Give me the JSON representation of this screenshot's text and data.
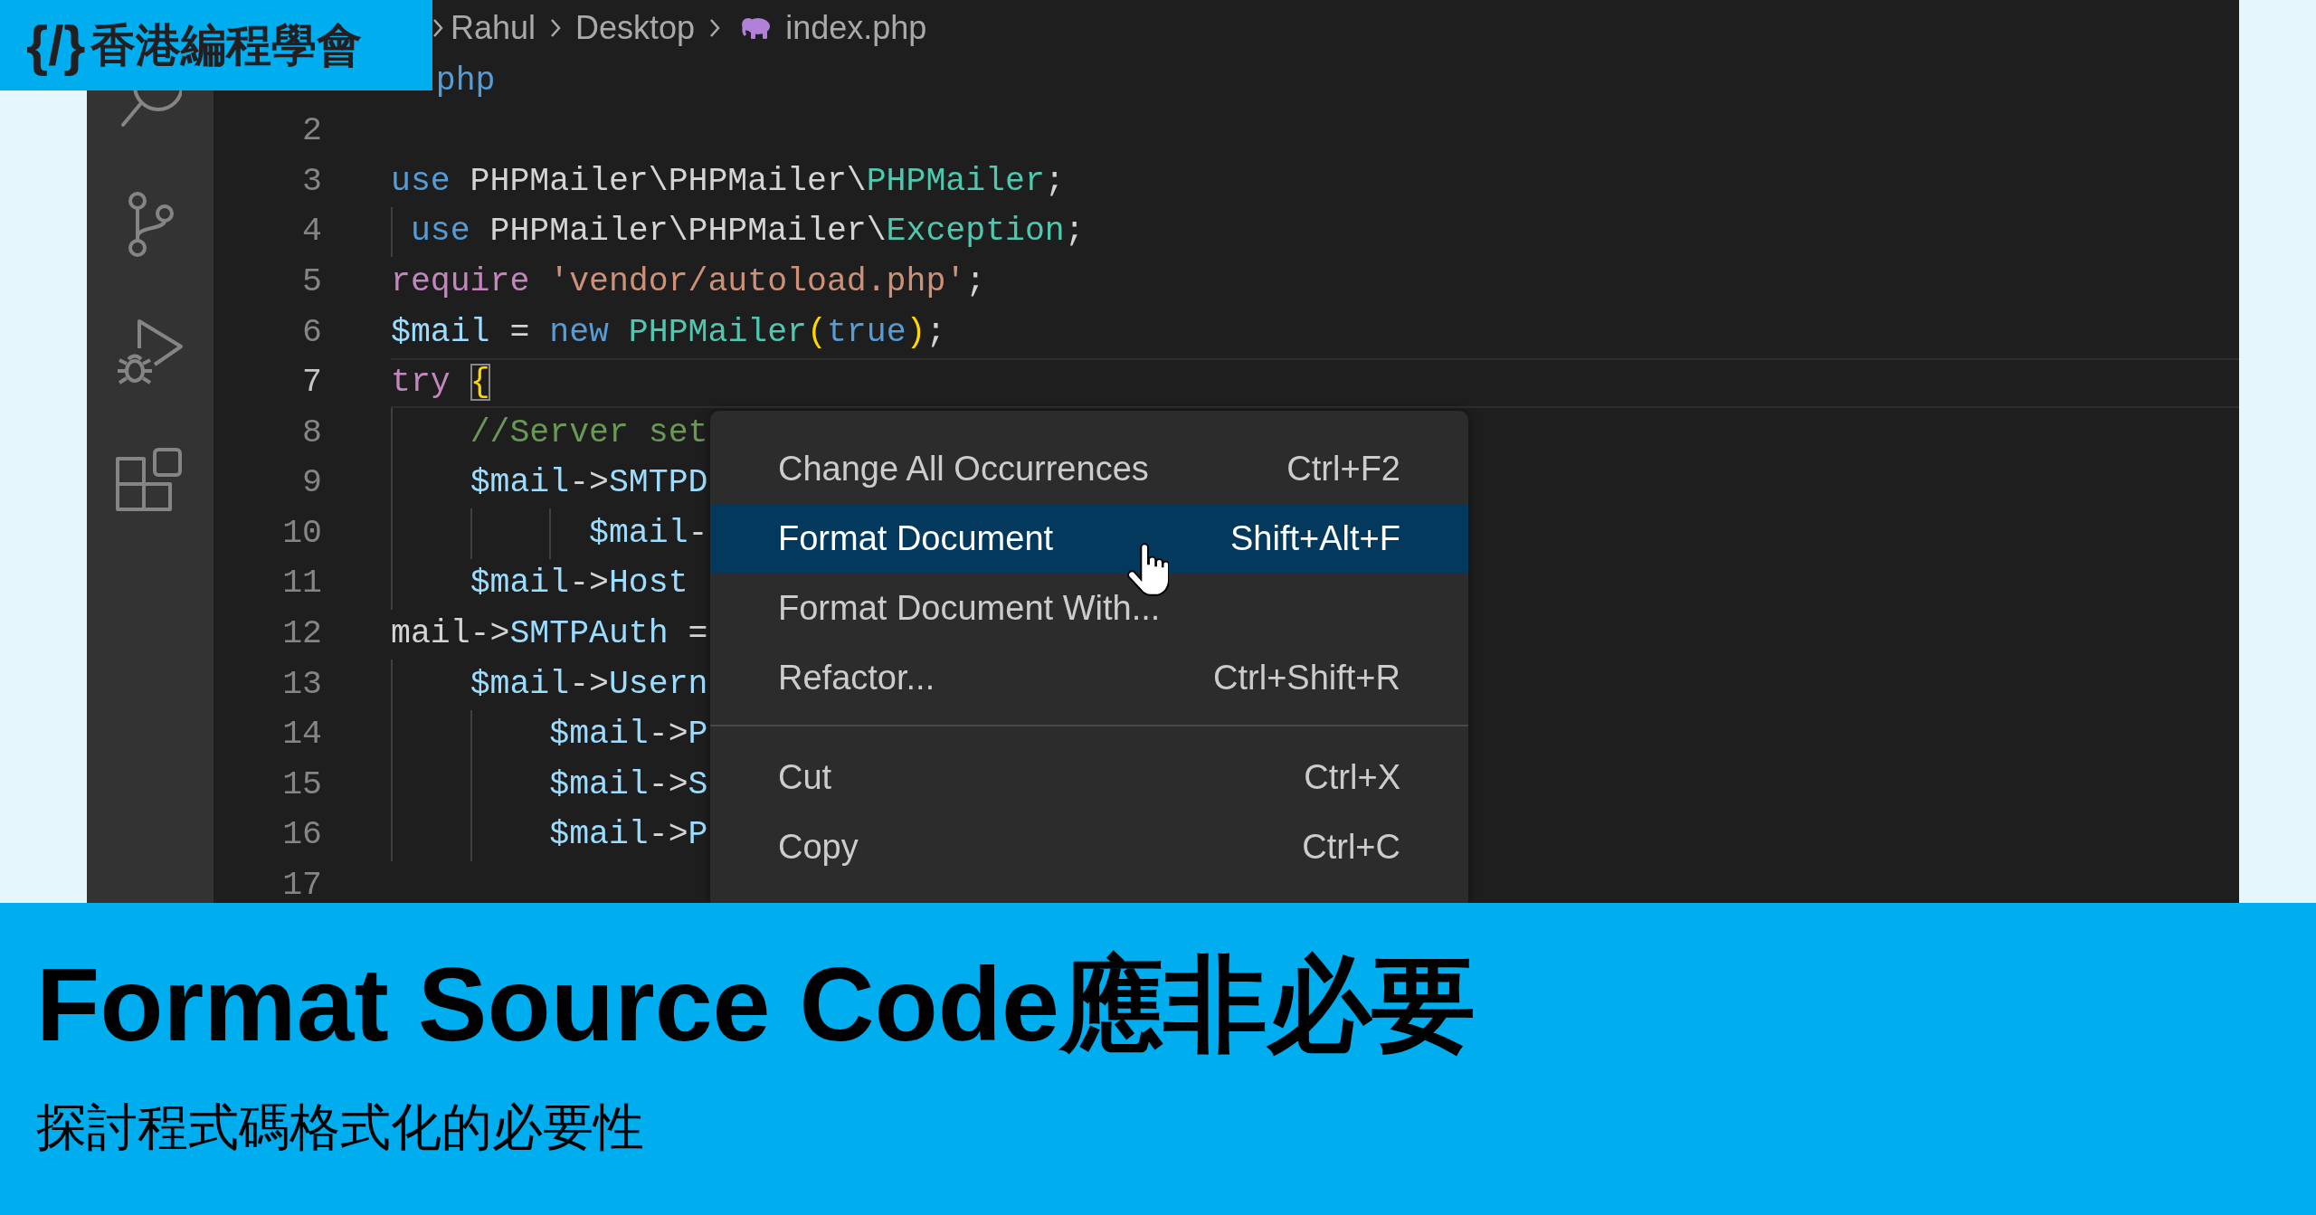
{
  "logo": {
    "mark": "{/}",
    "name": "香港編程學會"
  },
  "breadcrumb": [
    {
      "label": "Rahul",
      "kind": "folder"
    },
    {
      "label": "Desktop",
      "kind": "folder"
    },
    {
      "label": "index.php",
      "kind": "php-file"
    }
  ],
  "editor": {
    "lines": [
      {
        "active": false,
        "cut_start": true,
        "tokens": [
          {
            "kind": "keyword",
            "text": "php"
          }
        ]
      },
      {
        "number": "2",
        "active": false
      },
      {
        "number": "3",
        "active": false,
        "tokens": [
          {
            "kind": "keyword",
            "text": "use"
          },
          {
            "kind": "plain",
            "text": " PHPMailer\\PHPMailer\\"
          },
          {
            "kind": "class",
            "text": "PHPMailer"
          },
          {
            "kind": "plain",
            "text": ";"
          }
        ]
      },
      {
        "number": "4",
        "active": false,
        "tokens": [
          {
            "kind": "keyword",
            "text": " use"
          },
          {
            "kind": "plain",
            "text": " PHPMailer\\PHPMailer\\"
          },
          {
            "kind": "class",
            "text": "Exception"
          },
          {
            "kind": "plain",
            "text": ";"
          }
        ]
      },
      {
        "number": "5",
        "active": false,
        "tokens": [
          {
            "kind": "control",
            "text": "require"
          },
          {
            "kind": "string",
            "text": " 'vendor/autoload.php'"
          },
          {
            "kind": "plain",
            "text": ";"
          }
        ]
      },
      {
        "number": "6",
        "active": false,
        "tokens": [
          {
            "kind": "variable",
            "text": "$mail"
          },
          {
            "kind": "plain",
            "text": " = "
          },
          {
            "kind": "keyword",
            "text": "new"
          },
          {
            "kind": "class",
            "text": " PHPMailer"
          },
          {
            "kind": "bracket",
            "text": "("
          },
          {
            "kind": "keyword",
            "text": "true"
          },
          {
            "kind": "bracket",
            "text": ")"
          },
          {
            "kind": "plain",
            "text": ";"
          }
        ]
      },
      {
        "number": "7",
        "active": true,
        "tokens": [
          {
            "kind": "control",
            "text": "try "
          },
          {
            "kind": "bracket-match",
            "text": "{"
          }
        ]
      },
      {
        "number": "8",
        "active": false,
        "tokens": [
          {
            "kind": "comment",
            "text": "    //Server set"
          }
        ]
      },
      {
        "number": "9",
        "active": false,
        "tokens": [
          {
            "kind": "variable",
            "text": "    $mail"
          },
          {
            "kind": "plain",
            "text": "->"
          },
          {
            "kind": "property",
            "text": "SMTPD"
          }
        ]
      },
      {
        "number": "10",
        "active": false,
        "tokens": [
          {
            "kind": "variable",
            "text": "          $mail"
          },
          {
            "kind": "plain",
            "text": "-"
          }
        ]
      },
      {
        "number": "11",
        "active": false,
        "tokens": [
          {
            "kind": "variable",
            "text": "    $mail"
          },
          {
            "kind": "plain",
            "text": "->"
          },
          {
            "kind": "property",
            "text": "Host"
          }
        ]
      },
      {
        "number": "12",
        "active": false,
        "tokens": [
          {
            "kind": "plain",
            "text": "mail->"
          },
          {
            "kind": "property",
            "text": "SMTPAuth"
          },
          {
            "kind": "plain",
            "text": " ="
          }
        ]
      },
      {
        "number": "13",
        "active": false,
        "tokens": [
          {
            "kind": "variable",
            "text": "    $mail"
          },
          {
            "kind": "plain",
            "text": "->"
          },
          {
            "kind": "property",
            "text": "Usern"
          }
        ]
      },
      {
        "number": "14",
        "active": false,
        "tokens": [
          {
            "kind": "variable",
            "text": "        $mail"
          },
          {
            "kind": "plain",
            "text": "->"
          },
          {
            "kind": "property",
            "text": "P"
          }
        ]
      },
      {
        "number": "15",
        "active": false,
        "tokens": [
          {
            "kind": "variable",
            "text": "        $mail"
          },
          {
            "kind": "plain",
            "text": "->"
          },
          {
            "kind": "property",
            "text": "S"
          }
        ]
      },
      {
        "number": "16",
        "active": false,
        "tokens": [
          {
            "kind": "variable",
            "text": "        $mail"
          },
          {
            "kind": "plain",
            "text": "->"
          },
          {
            "kind": "property",
            "text": "P"
          }
        ]
      },
      {
        "number": "17",
        "active": false
      }
    ]
  },
  "context_menu": {
    "groups": [
      {
        "items": [
          {
            "label": "Change All Occurrences",
            "shortcut": "Ctrl+F2",
            "selected": false
          },
          {
            "label": "Format Document",
            "shortcut": "Shift+Alt+F",
            "selected": true
          },
          {
            "label": "Format Document With...",
            "selected": false
          },
          {
            "label": "Refactor...",
            "shortcut": "Ctrl+Shift+R",
            "selected": false
          }
        ]
      },
      {
        "items": [
          {
            "label": "Cut",
            "shortcut": "Ctrl+X",
            "selected": false
          },
          {
            "label": "Copy",
            "shortcut": "Ctrl+C",
            "selected": false
          }
        ]
      }
    ]
  },
  "banner": {
    "title": "Format Source Code應非必要",
    "subtitle": "探討程式碼格式化的必要性"
  }
}
